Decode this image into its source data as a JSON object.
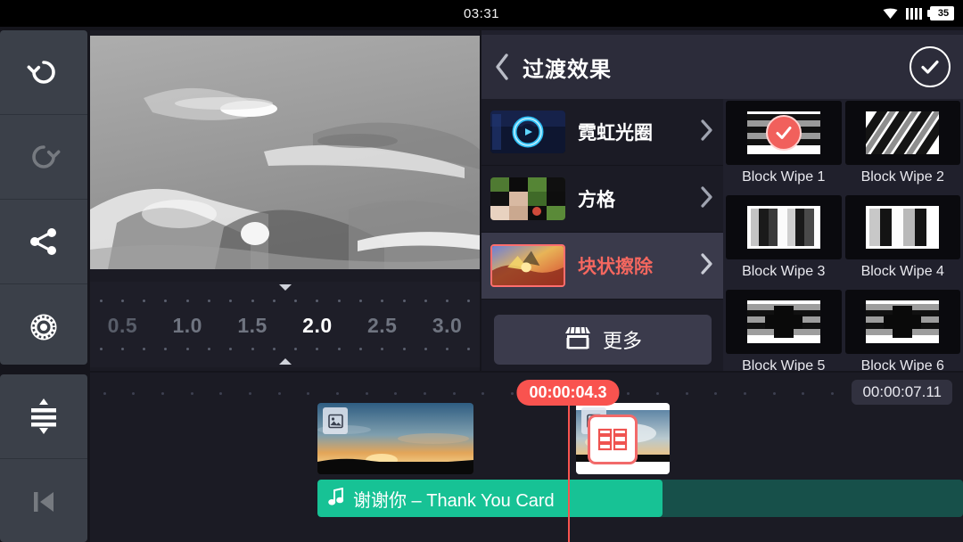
{
  "statusbar": {
    "clock": "03:31",
    "wifi_icon": "wifi-icon",
    "signal_icon": "signal-bars-icon",
    "battery_level": "35"
  },
  "toolbar": {
    "items": [
      {
        "name": "undo-button",
        "icon": "undo-icon",
        "enabled": true
      },
      {
        "name": "redo-button",
        "icon": "redo-icon",
        "enabled": false
      },
      {
        "name": "share-button",
        "icon": "share-icon",
        "enabled": true
      },
      {
        "name": "settings-button",
        "icon": "gear-icon",
        "enabled": true
      },
      {
        "name": "expand-tracks-button",
        "icon": "expand-rows-icon",
        "enabled": true
      },
      {
        "name": "skip-to-start-button",
        "icon": "skip-start-icon",
        "enabled": false
      }
    ]
  },
  "preview": {
    "description": "grayscale sky with clouds"
  },
  "duration_slider": {
    "ticks": [
      "0.5",
      "1.0",
      "1.5",
      "2.0",
      "2.5",
      "3.0"
    ],
    "selected": "2.0"
  },
  "panel": {
    "back_icon": "chevron-left-icon",
    "title": "过渡效果",
    "confirm_icon": "check-icon",
    "categories": [
      {
        "label": "霓虹光圈",
        "selected": false,
        "chevron": "chevron-right-icon"
      },
      {
        "label": "方格",
        "selected": false,
        "chevron": "chevron-right-icon"
      },
      {
        "label": "块状擦除",
        "selected": true,
        "chevron": "chevron-right-icon"
      }
    ],
    "more_button": {
      "label": "更多",
      "icon": "store-icon"
    },
    "effects": [
      {
        "label": "Block Wipe 1",
        "pattern": "horizontal-bars",
        "selected": true
      },
      {
        "label": "Block Wipe 2",
        "pattern": "diagonal-stripes",
        "selected": false
      },
      {
        "label": "Block Wipe 3",
        "pattern": "vertical-bars-a",
        "selected": false
      },
      {
        "label": "Block Wipe 4",
        "pattern": "vertical-bars-b",
        "selected": false
      },
      {
        "label": "Block Wipe 5",
        "pattern": "cross-block",
        "selected": false
      },
      {
        "label": "Block Wipe 6",
        "pattern": "cross-block",
        "selected": false
      }
    ],
    "selected_check_icon": "check-circle-icon"
  },
  "timeline": {
    "playhead_time": "00:00:04.3",
    "total_time": "00:00:07.11",
    "clip1_icon": "image-icon",
    "clip2_icon": "image-icon",
    "transition_icon": "transition-block-icon",
    "audio": {
      "icon": "music-note-icon",
      "title": "谢谢你 – Thank You Card"
    }
  },
  "colors": {
    "accent_red": "#f9534f",
    "selected_text": "#f4675f",
    "audio_green": "#17c295",
    "panel_bg": "#20202c",
    "toolbar_btn": "#3b4049"
  }
}
